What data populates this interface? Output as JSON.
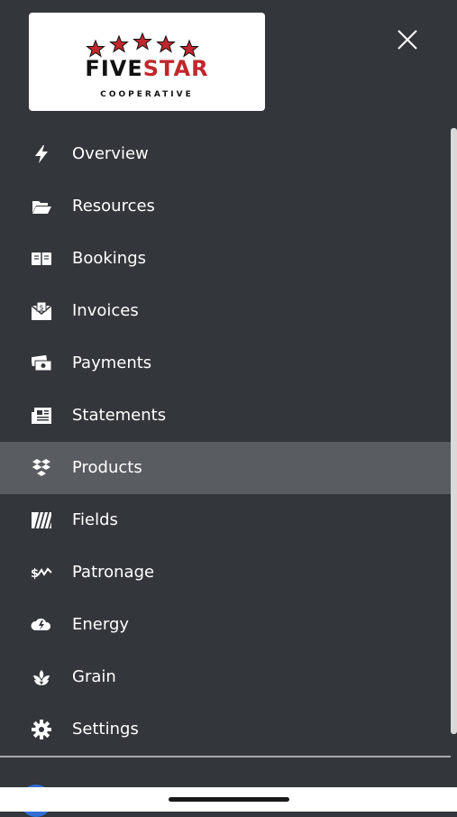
{
  "logo": {
    "brand_part1": "FIVE",
    "brand_part2": "STAR",
    "subtitle": "COOPERATIVE",
    "colors": {
      "dark": "#111111",
      "red": "#c1272d"
    }
  },
  "header": {
    "close_icon": "close-icon"
  },
  "menu": {
    "items": [
      {
        "label": "Overview",
        "icon": "lightning-icon"
      },
      {
        "label": "Resources",
        "icon": "folder-open-icon"
      },
      {
        "label": "Bookings",
        "icon": "book-open-icon"
      },
      {
        "label": "Invoices",
        "icon": "invoice-envelope-icon"
      },
      {
        "label": "Payments",
        "icon": "money-bills-icon"
      },
      {
        "label": "Statements",
        "icon": "newspaper-icon"
      },
      {
        "label": "Products",
        "icon": "dropbox-boxes-icon",
        "active": true
      },
      {
        "label": "Fields",
        "icon": "field-lines-icon"
      },
      {
        "label": "Patronage",
        "icon": "dollar-trend-icon"
      },
      {
        "label": "Energy",
        "icon": "cloud-bolt-icon"
      },
      {
        "label": "Grain",
        "icon": "seedling-icon"
      },
      {
        "label": "Settings",
        "icon": "gear-icon"
      }
    ]
  },
  "colors": {
    "background": "#33363b",
    "active_row": "#595c60",
    "text": "#ffffff"
  }
}
